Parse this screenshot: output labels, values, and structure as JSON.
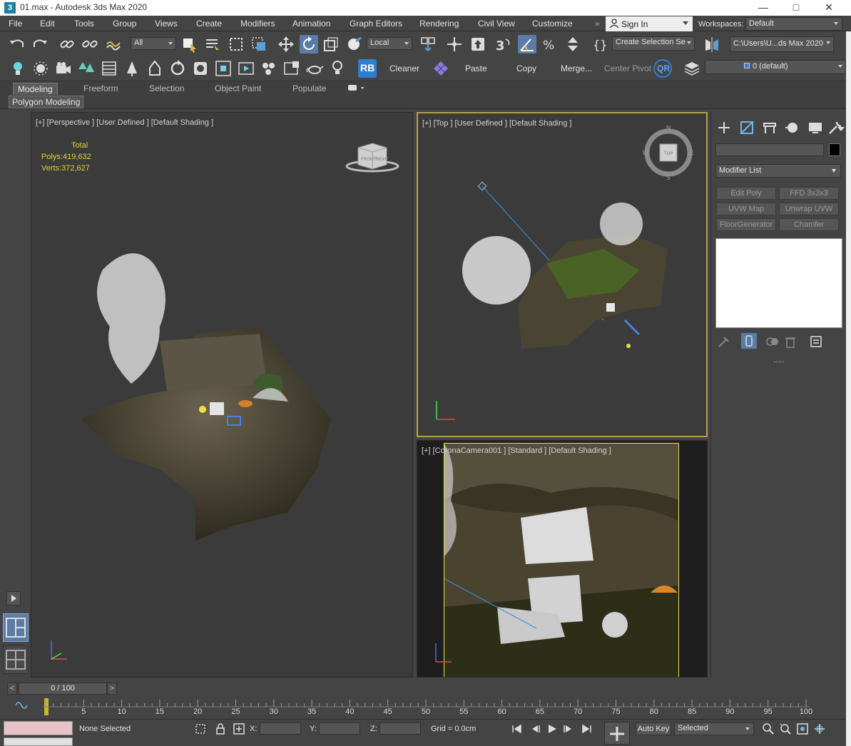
{
  "window": {
    "title": "01.max - Autodesk 3ds Max 2020",
    "app_icon": "3"
  },
  "menu": [
    "File",
    "Edit",
    "Tools",
    "Group",
    "Views",
    "Create",
    "Modifiers",
    "Animation",
    "Graph Editors",
    "Rendering",
    "Civil View",
    "Customize"
  ],
  "account": {
    "sign_in": "Sign In",
    "workspaces_label": "Workspaces:",
    "workspace": "Default"
  },
  "toolbar1": {
    "selection_filter": "All",
    "ref_coord": "Local",
    "named_selection": "Create Selection Se",
    "project_path": "C:\\Users\\U...ds Max 2020"
  },
  "toolbar2": {
    "rb_label": "RB",
    "cleaner": "Cleaner",
    "paste": "Paste",
    "copy": "Copy",
    "merge": "Merge...",
    "center_pivot": "Center Pivot",
    "qr_label": "QR",
    "layer": "0 (default)"
  },
  "ribbon": {
    "tabs": [
      "Modeling",
      "Freeform",
      "Selection",
      "Object Paint",
      "Populate"
    ],
    "active_tab": "Modeling",
    "panel": "Polygon Modeling"
  },
  "viewports": {
    "perspective": {
      "label": "[+] [Perspective ] [User Defined ] [Default Shading ]",
      "stats": {
        "total_label": "Total",
        "polys_label": "Polys:",
        "polys": "419,632",
        "verts_label": "Verts:",
        "verts": "372,627"
      },
      "viewcube_front": "FRONT",
      "viewcube_right": "RIGHT"
    },
    "top": {
      "label": "[+] [Top ] [User Defined ] [Default Shading ]",
      "compass": {
        "n": "N",
        "s": "S",
        "e": "E",
        "w": "W",
        "face": "TOP"
      }
    },
    "camera": {
      "label": "[+] [CoronaCamera001 ] [Standard ] [Default Shading ]"
    }
  },
  "command_panel": {
    "modifier_list": "Modifier List",
    "buttons": [
      "Edit Poly",
      "FFD 3x3x3",
      "UVW Map",
      "Unwrap UVW",
      "FloorGenerator",
      "Chamfer"
    ]
  },
  "timeline": {
    "slider": "0 / 100",
    "ticks": [
      5,
      10,
      15,
      20,
      25,
      30,
      35,
      40,
      45,
      50,
      55,
      60,
      65,
      70,
      75,
      80,
      85,
      90,
      95,
      100
    ]
  },
  "status": {
    "selection": "None Selected",
    "x_label": "X:",
    "y_label": "Y:",
    "z_label": "Z:",
    "grid": "Grid = 0.0cm",
    "auto_key": "Auto Key",
    "key_filter": "Selected"
  }
}
